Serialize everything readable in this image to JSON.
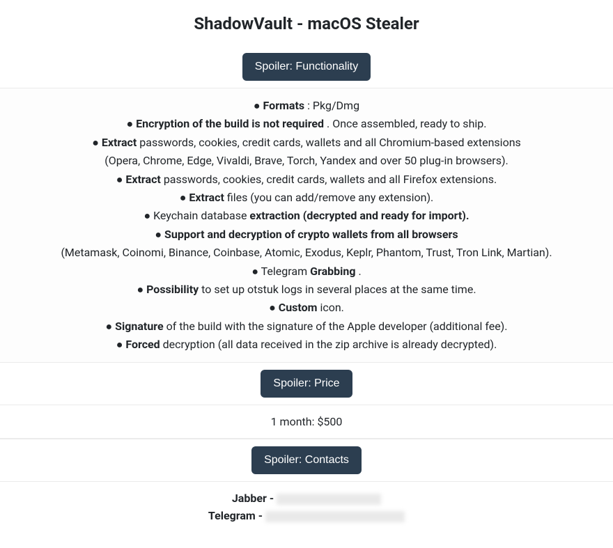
{
  "title": "ShadowVault - macOS Stealer",
  "spoilers": {
    "functionality": "Spoiler: Functionality",
    "price": "Spoiler: Price",
    "contacts": "Spoiler: Contacts"
  },
  "functionality": {
    "l1_bullet": "● ",
    "l1_b": "Formats",
    "l1_rest": " : Pkg/Dmg",
    "l2_bullet": "● ",
    "l2_b": "Encryption of the build is not required",
    "l2_rest": " . Once assembled, ready to ship.",
    "l3_bullet": "● ",
    "l3_b": "Extract",
    "l3_rest": " passwords, cookies, credit cards, wallets and all Chromium-based extensions",
    "l4": "(Opera, Chrome, Edge, Vivaldi, Brave, Torch, Yandex and over 50 plug-in browsers).",
    "l5_bullet": "● ",
    "l5_b": "Extract",
    "l5_rest": " passwords, cookies, credit cards, wallets and all Firefox extensions.",
    "l6_bullet": "● ",
    "l6_b": "Extract",
    "l6_rest": " files (you can add/remove any extension).",
    "l7_pre": "● Keychain database ",
    "l7_b": "extraction (decrypted and ready for import).",
    "l8_bullet": "● ",
    "l8_b": "Support and decryption of crypto wallets from all browsers",
    "l9": "(Metamask, Coinomi, Binance, Coinbase, Atomic, Exodus, Keplr, Phantom, Trust, Tron Link, Martian).",
    "l10_pre": "● Telegram ",
    "l10_b": "Grabbing",
    "l10_rest": " .",
    "l11_bullet": "● ",
    "l11_b": "Possibility",
    "l11_rest": " to set up otstuk logs in several places at the same time.",
    "l12_bullet": "● ",
    "l12_b": "Custom",
    "l12_rest": " icon.",
    "l13_bullet": "● ",
    "l13_b": "Signature",
    "l13_rest": " of the build with the signature of the Apple developer (additional fee).",
    "l14_bullet": "● ",
    "l14_b": "Forced",
    "l14_rest": " decryption (all data received in the zip archive is already decrypted)."
  },
  "price": "1 month: $500",
  "contacts": {
    "jabber": "Jabber - ",
    "telegram": "Telegram - "
  }
}
